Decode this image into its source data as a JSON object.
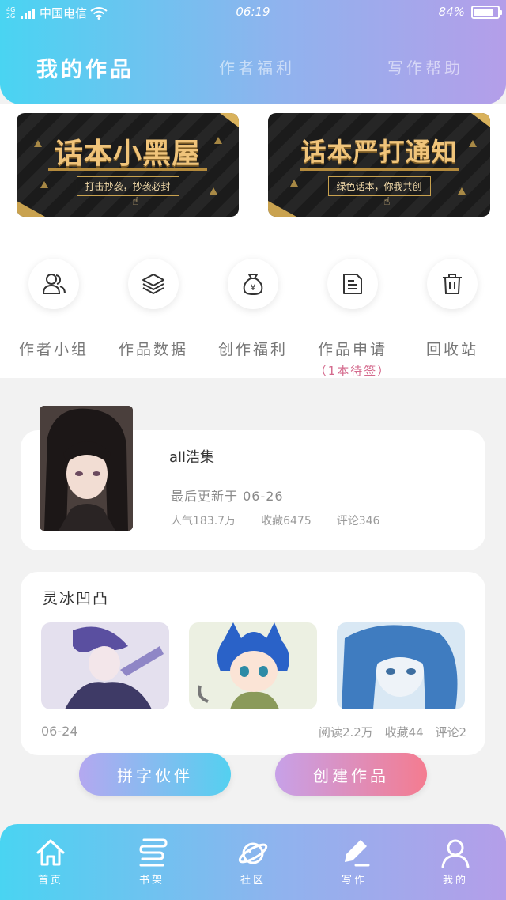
{
  "status_bar": {
    "network_badge": "4G 2G",
    "carrier": "中国电信",
    "time": "06:19",
    "battery": "84%",
    "battery_level": 0.84
  },
  "top_tabs": [
    {
      "label": "我的作品",
      "active": true
    },
    {
      "label": "作者福利",
      "active": false
    },
    {
      "label": "写作帮助",
      "active": false
    }
  ],
  "banners": [
    {
      "title": "话本小黑屋",
      "subtitle": "打击抄袭，抄袭必封"
    },
    {
      "title": "话本严打通知",
      "subtitle": "绿色话本，你我共创"
    }
  ],
  "tools": [
    {
      "label": "作者小组",
      "icon": "users-icon"
    },
    {
      "label": "作品数据",
      "icon": "layers-icon"
    },
    {
      "label": "创作福利",
      "icon": "money-bag-icon"
    },
    {
      "label": "作品申请",
      "sub": "（1本待签）",
      "icon": "document-icon"
    },
    {
      "label": "回收站",
      "icon": "trash-icon"
    }
  ],
  "work": {
    "title": "all浩集",
    "updated": "最后更新于 06-26",
    "popularity": "人气183.7万",
    "favorites": "收藏6475",
    "comments": "评论346"
  },
  "update": {
    "title": "灵冰凹凸",
    "date": "06-24",
    "reads": "阅读2.2万",
    "favorites": "收藏44",
    "comments": "评论2"
  },
  "buttons": {
    "partner": "拼字伙伴",
    "create": "创建作品"
  },
  "bottom_nav": [
    {
      "label": "首页",
      "icon": "home-icon"
    },
    {
      "label": "书架",
      "icon": "bookshelf-icon"
    },
    {
      "label": "社区",
      "icon": "planet-icon"
    },
    {
      "label": "写作",
      "icon": "pen-icon",
      "active": true
    },
    {
      "label": "我的",
      "icon": "profile-icon"
    }
  ],
  "colors": {
    "gradient_start": "#49d4f2",
    "gradient_end": "#b49ee9",
    "accent_pink": "#d46a8d",
    "banner_gold": "#f0c47a"
  }
}
